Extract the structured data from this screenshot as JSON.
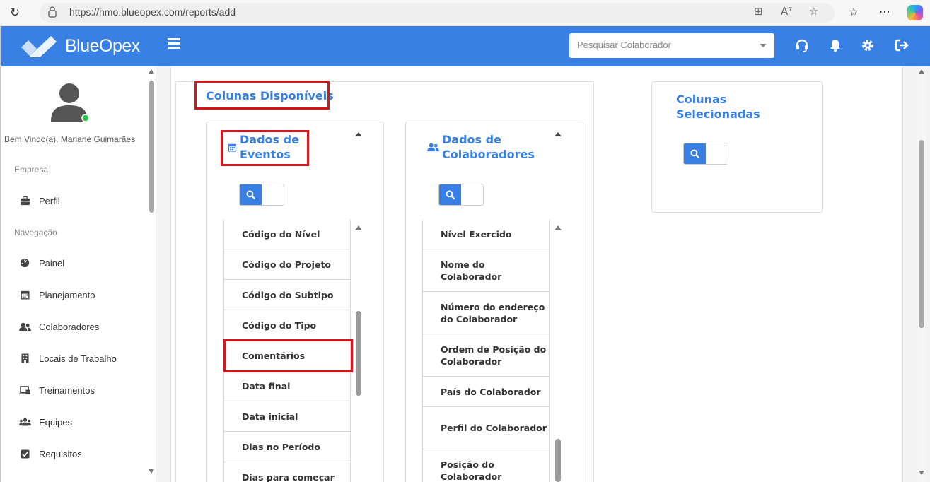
{
  "browser": {
    "url": "https://hmo.blueopex.com/reports/add"
  },
  "app": {
    "brand": "BlueOpex",
    "search_placeholder": "Pesquisar Colaborador"
  },
  "sidebar": {
    "welcome": "Bem Vindo(a), Mariane Guimarães",
    "section_company": "Empresa",
    "section_nav": "Navegação",
    "items": [
      {
        "label": "Perfil",
        "icon": "briefcase-icon"
      },
      {
        "label": "Painel",
        "icon": "dashboard-icon"
      },
      {
        "label": "Planejamento",
        "icon": "calendar-icon"
      },
      {
        "label": "Colaboradores",
        "icon": "users-icon"
      },
      {
        "label": "Locais de Trabalho",
        "icon": "building-icon"
      },
      {
        "label": "Treinamentos",
        "icon": "training-icon"
      },
      {
        "label": "Equipes",
        "icon": "team-icon"
      },
      {
        "label": "Requisitos",
        "icon": "checkbox-icon"
      }
    ]
  },
  "main": {
    "available_title": "Colunas Disponíveis",
    "selected_title": "Colunas Selecionadas",
    "events_title": "Dados de Eventos",
    "collaborators_title": "Dados de Colaboradores",
    "events_items": [
      "Código do Nível",
      "Código do Projeto",
      "Código do Subtipo",
      "Código do Tipo",
      "Comentários",
      "Data final",
      "Data inicial",
      "Dias no Período",
      "Dias para começar"
    ],
    "collab_items": [
      "Nível Exercido",
      "Nome do Colaborador",
      "Número do endereço do Colaborador",
      "Ordem de Posição do Colaborador",
      "País do Colaborador",
      "Perfil do Colaborador",
      "Posição do Colaborador"
    ]
  },
  "colors": {
    "primary": "#3880e3",
    "highlight": "#d9141b"
  }
}
